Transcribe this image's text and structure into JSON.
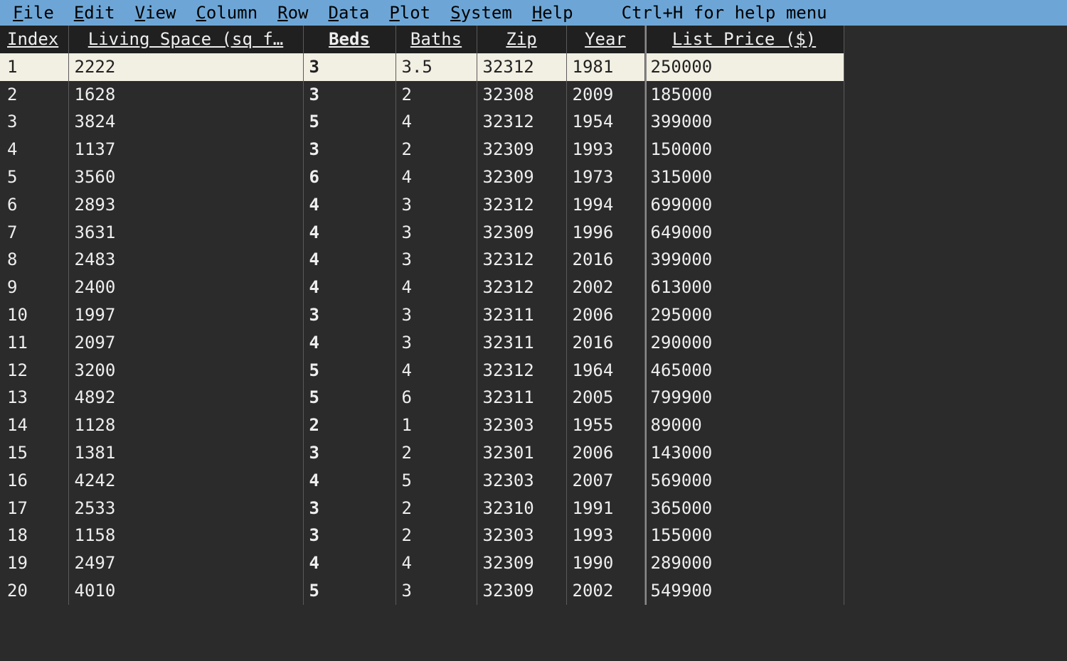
{
  "menu": {
    "items": [
      {
        "underline": "F",
        "rest": "ile"
      },
      {
        "underline": "E",
        "rest": "dit"
      },
      {
        "underline": "V",
        "rest": "iew"
      },
      {
        "underline": "C",
        "rest": "olumn"
      },
      {
        "underline": "R",
        "rest": "ow"
      },
      {
        "underline": "D",
        "rest": "ata"
      },
      {
        "underline": "P",
        "rest": "lot"
      },
      {
        "underline": "S",
        "rest": "ystem"
      },
      {
        "underline": "H",
        "rest": "elp"
      }
    ],
    "hint": "Ctrl+H for help menu"
  },
  "columns": [
    {
      "key": "index",
      "label": "Index",
      "class": "col-index",
      "isKey": false
    },
    {
      "key": "living",
      "label": "Living Space (sq f…",
      "class": "col-living",
      "isKey": false
    },
    {
      "key": "beds",
      "label": "Beds",
      "class": "col-beds",
      "isKey": true
    },
    {
      "key": "baths",
      "label": "Baths",
      "class": "col-baths",
      "isKey": false
    },
    {
      "key": "zip",
      "label": "Zip",
      "class": "col-zip",
      "isKey": false
    },
    {
      "key": "year",
      "label": "Year",
      "class": "col-year",
      "isKey": false
    },
    {
      "key": "price",
      "label": "List Price ($)",
      "class": "col-price",
      "isKey": false
    }
  ],
  "selectedRow": 0,
  "rows": [
    {
      "index": "1",
      "living": "2222",
      "beds": "3",
      "baths": "3.5",
      "zip": "32312",
      "year": "1981",
      "price": "250000"
    },
    {
      "index": "2",
      "living": "1628",
      "beds": "3",
      "baths": "2",
      "zip": "32308",
      "year": "2009",
      "price": "185000"
    },
    {
      "index": "3",
      "living": "3824",
      "beds": "5",
      "baths": "4",
      "zip": "32312",
      "year": "1954",
      "price": "399000"
    },
    {
      "index": "4",
      "living": "1137",
      "beds": "3",
      "baths": "2",
      "zip": "32309",
      "year": "1993",
      "price": "150000"
    },
    {
      "index": "5",
      "living": "3560",
      "beds": "6",
      "baths": "4",
      "zip": "32309",
      "year": "1973",
      "price": "315000"
    },
    {
      "index": "6",
      "living": "2893",
      "beds": "4",
      "baths": "3",
      "zip": "32312",
      "year": "1994",
      "price": "699000"
    },
    {
      "index": "7",
      "living": "3631",
      "beds": "4",
      "baths": "3",
      "zip": "32309",
      "year": "1996",
      "price": "649000"
    },
    {
      "index": "8",
      "living": "2483",
      "beds": "4",
      "baths": "3",
      "zip": "32312",
      "year": "2016",
      "price": "399000"
    },
    {
      "index": "9",
      "living": "2400",
      "beds": "4",
      "baths": "4",
      "zip": "32312",
      "year": "2002",
      "price": "613000"
    },
    {
      "index": "10",
      "living": "1997",
      "beds": "3",
      "baths": "3",
      "zip": "32311",
      "year": "2006",
      "price": "295000"
    },
    {
      "index": "11",
      "living": "2097",
      "beds": "4",
      "baths": "3",
      "zip": "32311",
      "year": "2016",
      "price": "290000"
    },
    {
      "index": "12",
      "living": "3200",
      "beds": "5",
      "baths": "4",
      "zip": "32312",
      "year": "1964",
      "price": "465000"
    },
    {
      "index": "13",
      "living": "4892",
      "beds": "5",
      "baths": "6",
      "zip": "32311",
      "year": "2005",
      "price": "799900"
    },
    {
      "index": "14",
      "living": "1128",
      "beds": "2",
      "baths": "1",
      "zip": "32303",
      "year": "1955",
      "price": "89000"
    },
    {
      "index": "15",
      "living": "1381",
      "beds": "3",
      "baths": "2",
      "zip": "32301",
      "year": "2006",
      "price": "143000"
    },
    {
      "index": "16",
      "living": "4242",
      "beds": "4",
      "baths": "5",
      "zip": "32303",
      "year": "2007",
      "price": "569000"
    },
    {
      "index": "17",
      "living": "2533",
      "beds": "3",
      "baths": "2",
      "zip": "32310",
      "year": "1991",
      "price": "365000"
    },
    {
      "index": "18",
      "living": "1158",
      "beds": "3",
      "baths": "2",
      "zip": "32303",
      "year": "1993",
      "price": "155000"
    },
    {
      "index": "19",
      "living": "2497",
      "beds": "4",
      "baths": "4",
      "zip": "32309",
      "year": "1990",
      "price": "289000"
    },
    {
      "index": "20",
      "living": "4010",
      "beds": "5",
      "baths": "3",
      "zip": "32309",
      "year": "2002",
      "price": "549900"
    }
  ]
}
